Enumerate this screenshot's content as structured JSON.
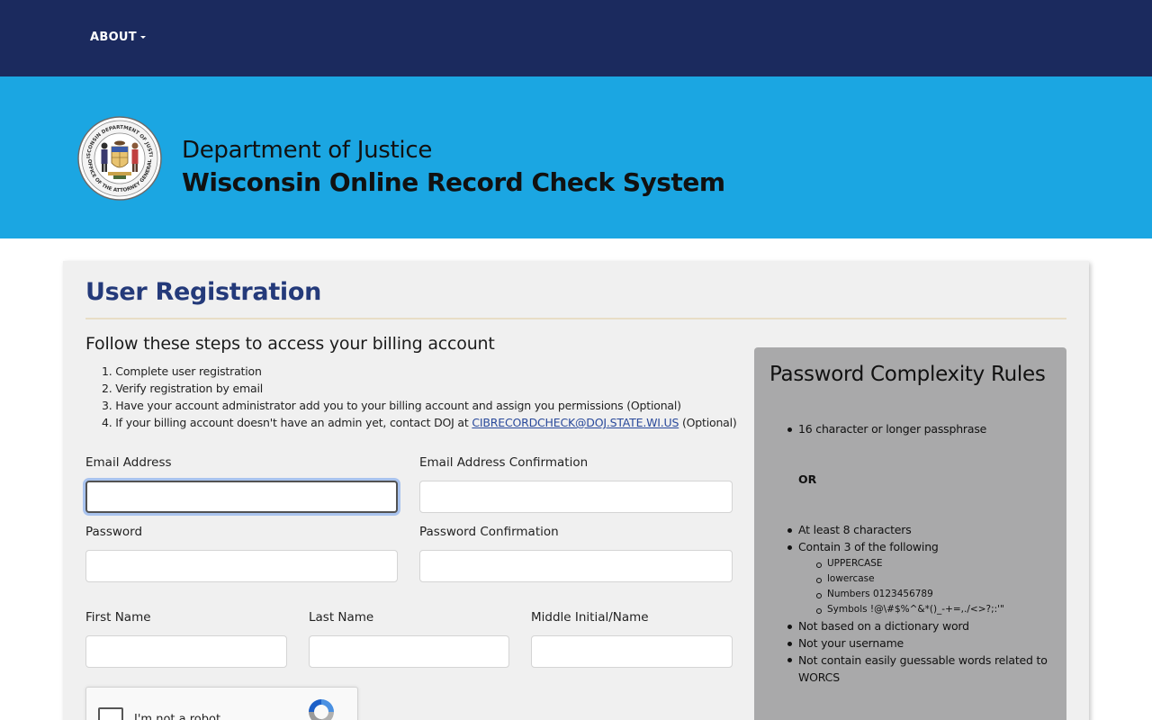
{
  "nav": {
    "about_label": "ABOUT"
  },
  "header": {
    "department": "Department of Justice",
    "system": "Wisconsin Online Record Check System",
    "seal_text_top": "WISCONSIN DEPARTMENT OF JUSTICE",
    "seal_text_bottom": "OFFICE OF THE ATTORNEY GENERAL"
  },
  "page": {
    "title": "User Registration",
    "steps_heading": "Follow these steps to access your billing account",
    "steps": [
      "1. Complete user registration",
      "2. Verify registration by email",
      "3. Have your account administrator add you to your billing account and assign you permissions (Optional)",
      "4. If your billing account doesn't have an admin yet, contact DOJ at "
    ],
    "step4_email": "CIBRECORDCHECK@DOJ.STATE.WI.US",
    "step4_suffix": " (Optional)"
  },
  "form": {
    "email_label": "Email Address",
    "email_value": "",
    "email_confirm_label": "Email Address Confirmation",
    "email_confirm_value": "",
    "password_label": "Password",
    "password_value": "",
    "password_confirm_label": "Password Confirmation",
    "password_confirm_value": "",
    "first_name_label": "First Name",
    "first_name_value": "",
    "last_name_label": "Last Name",
    "last_name_value": "",
    "middle_label": "Middle Initial/Name",
    "middle_value": ""
  },
  "captcha": {
    "label": "I'm not a robot"
  },
  "rules": {
    "title": "Password Complexity Rules",
    "passphrase": "16 character or longer passphrase",
    "or": "OR",
    "min_chars": "At least 8 characters",
    "contain": "Contain 3 of the following",
    "upper": "UPPERCASE",
    "lower": "lowercase",
    "numbers": "Numbers 0123456789",
    "symbols": "Symbols !@\\#$%^&*()_-+=,./<>?;:'\"",
    "dictionary": "Not based on a dictionary word",
    "username": "Not your username",
    "guessable": "Not contain easily guessable words related to WORCS"
  },
  "colors": {
    "nav_bg": "#1b2a5e",
    "banner_bg": "#1ba6e2",
    "title_blue": "#243a7a",
    "card_bg": "#f0f0f0",
    "rules_bg": "#a9a9aa"
  }
}
